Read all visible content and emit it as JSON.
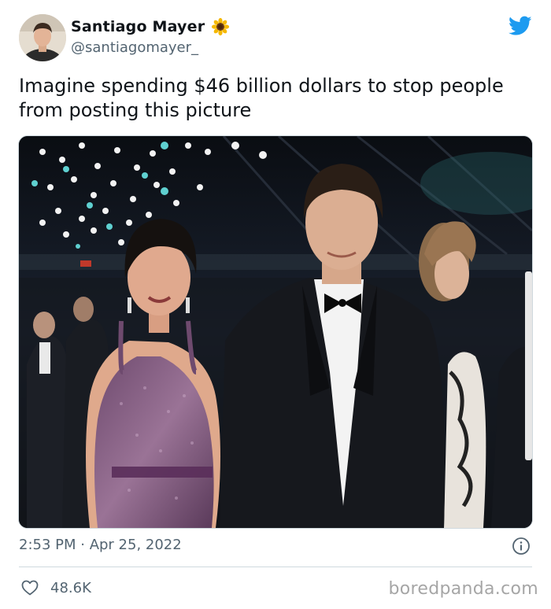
{
  "author": {
    "display_name": "Santiago Mayer",
    "handle": "@santiagomayer_",
    "name_emoji": "sunflower-icon"
  },
  "tweet": {
    "text": "Imagine spending $46 billion dollars to stop people from posting this picture",
    "timestamp": "2:53 PM · Apr 25, 2022",
    "like_count": "48.6K"
  },
  "media": {
    "description_icon": "photo"
  },
  "watermark": "boredpanda.com",
  "colors": {
    "twitter_blue": "#1d9bf0",
    "secondary_text": "#536471",
    "divider": "#cfd9de",
    "watermark": "#a6a6a6"
  }
}
